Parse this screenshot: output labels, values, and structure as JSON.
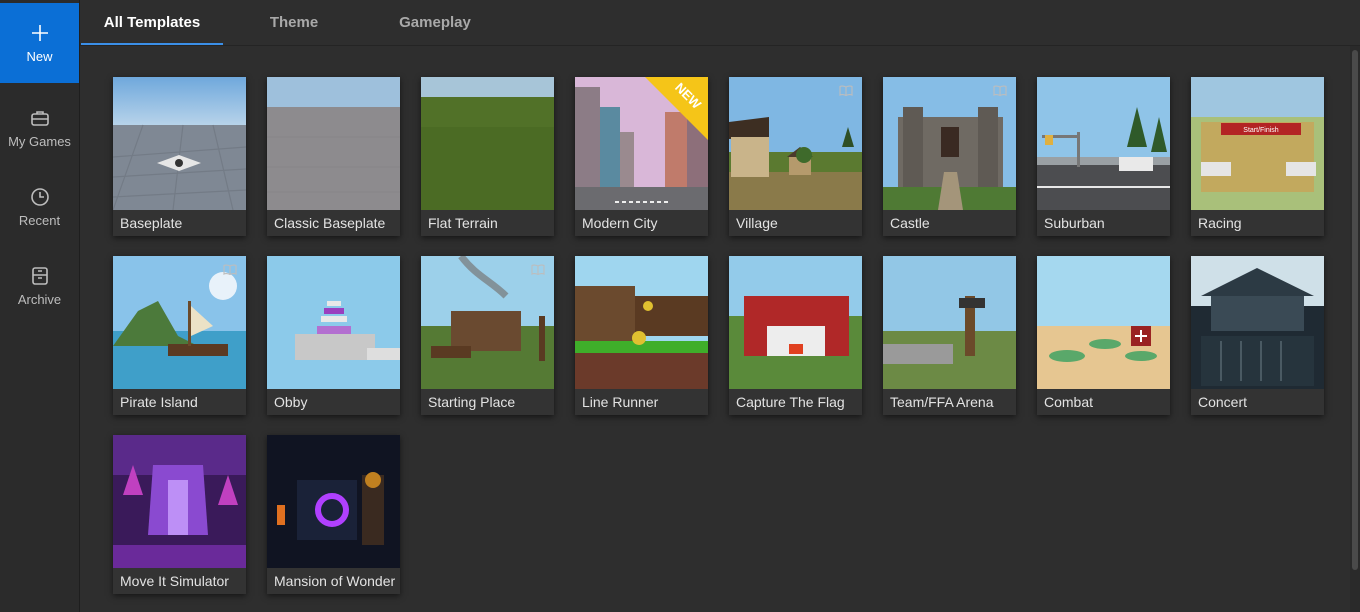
{
  "sidebar": {
    "items": [
      {
        "label": "New",
        "icon": "plus-icon",
        "active": true
      },
      {
        "label": "My Games",
        "icon": "briefcase-icon",
        "active": false
      },
      {
        "label": "Recent",
        "icon": "clock-icon",
        "active": false
      },
      {
        "label": "Archive",
        "icon": "archive-icon",
        "active": false
      }
    ]
  },
  "tabs": [
    {
      "label": "All Templates",
      "active": true
    },
    {
      "label": "Theme",
      "active": false
    },
    {
      "label": "Gameplay",
      "active": false
    }
  ],
  "templates": [
    {
      "name": "Baseplate",
      "tutorial": false
    },
    {
      "name": "Classic Baseplate",
      "tutorial": false
    },
    {
      "name": "Flat Terrain",
      "tutorial": false
    },
    {
      "name": "Modern City",
      "tutorial": false,
      "badge": "NEW"
    },
    {
      "name": "Village",
      "tutorial": true
    },
    {
      "name": "Castle",
      "tutorial": true
    },
    {
      "name": "Suburban",
      "tutorial": false
    },
    {
      "name": "Racing",
      "tutorial": false,
      "sign": "Start/Finish"
    },
    {
      "name": "Pirate Island",
      "tutorial": true
    },
    {
      "name": "Obby",
      "tutorial": false
    },
    {
      "name": "Starting Place",
      "tutorial": true
    },
    {
      "name": "Line Runner",
      "tutorial": false
    },
    {
      "name": "Capture The Flag",
      "tutorial": false
    },
    {
      "name": "Team/FFA Arena",
      "tutorial": false
    },
    {
      "name": "Combat",
      "tutorial": false
    },
    {
      "name": "Concert",
      "tutorial": false
    },
    {
      "name": "Move It Simulator",
      "tutorial": false
    },
    {
      "name": "Mansion of Wonder",
      "tutorial": false
    }
  ],
  "colors": {
    "accent": "#0b6fd6",
    "tab_underline": "#3b8fe8",
    "background": "#2e2e2e",
    "new_badge": "#f5c518"
  }
}
